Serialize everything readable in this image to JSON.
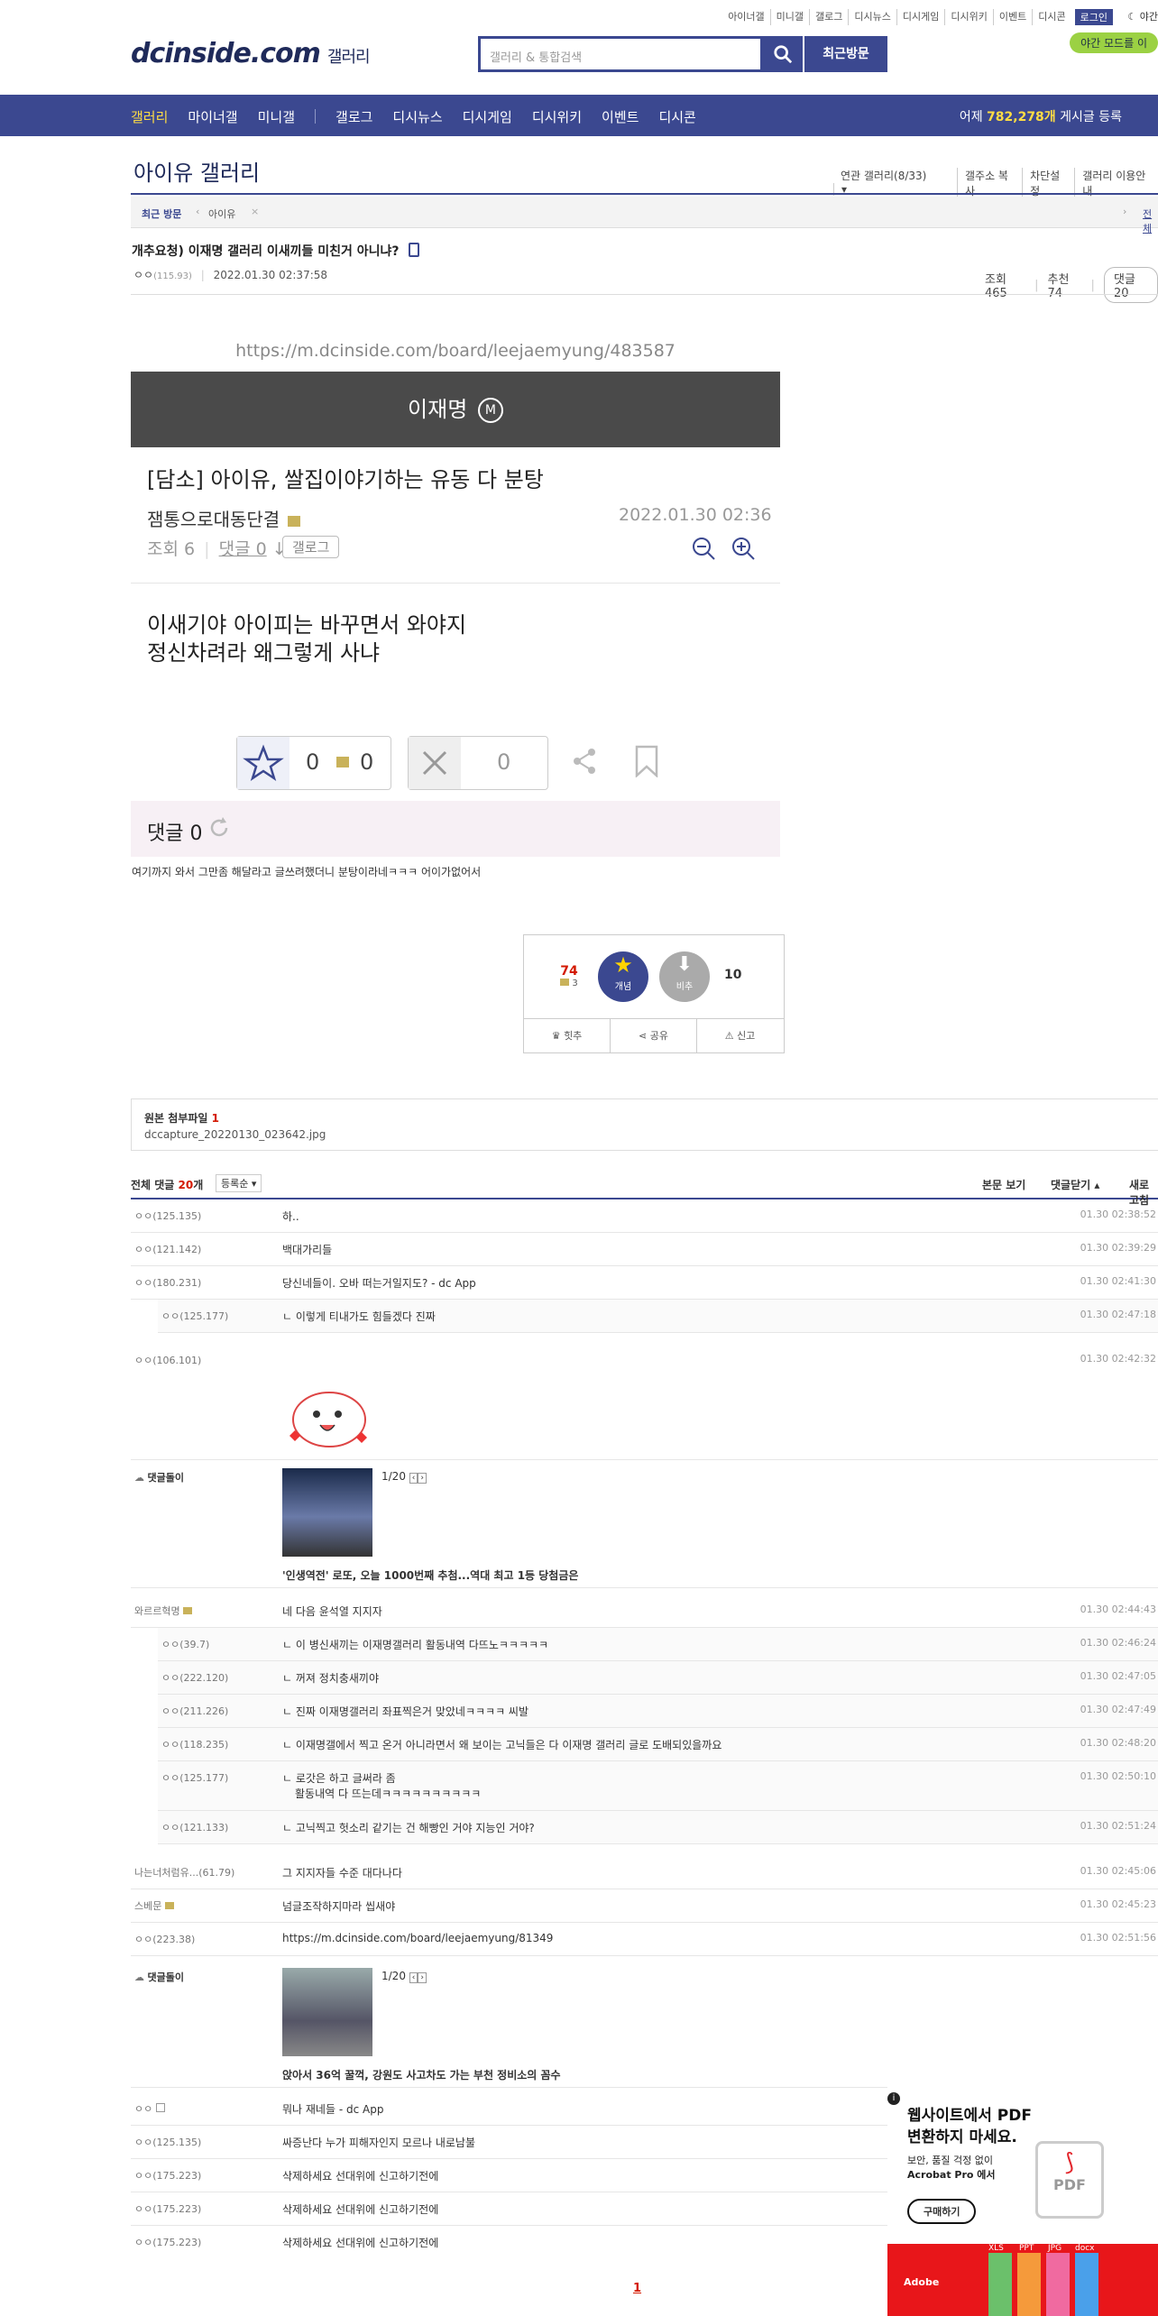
{
  "topnav": [
    "아이너갤",
    "미니갤",
    "갤로그",
    "디시뉴스",
    "디시게임",
    "디시위키",
    "이벤트",
    "디시콘"
  ],
  "login": "로그인",
  "night_label": "야간",
  "night_mode": "야간 모드를 이",
  "logo": "dcinside.com",
  "logo_suffix": "갤러리",
  "search_placeholder": "갤러리 & 통합검색",
  "recent_visit": "최근방문",
  "gnb": {
    "items": [
      "갤러리",
      "마이너갤",
      "미니갤",
      "갤로그",
      "디시뉴스",
      "디시게임",
      "디시위키",
      "이벤트",
      "디시콘"
    ],
    "stat_prefix": "어제",
    "stat_value": "782,278개",
    "stat_suffix": "게시글 등록"
  },
  "gallery_title": "아이유 갤러리",
  "gallery_tools": [
    "연관 갤러리(8/33)",
    "갤주소 복사",
    "차단설정",
    "갤러리 이용안내"
  ],
  "recentbar": {
    "label": "최근 방문",
    "item": "아이유",
    "right": "전체"
  },
  "post": {
    "title": "개추요청) 이재명 갤러리 이새끼들 미친거 아니냐?",
    "author": "ㅇㅇ",
    "ip": "(115.93)",
    "date": "2022.01.30 02:37:58",
    "views_label": "조회",
    "views": "465",
    "recommend_label": "추천",
    "recommend": "74",
    "comments_label": "댓글",
    "comments": "20"
  },
  "shot": {
    "url": "https://m.dcinside.com/board/leejaemyung/483587",
    "header": "이재명",
    "title": "[담소] 아이유, 쌀집이야기하는 유동 다 분탕",
    "author": "잼통으로대동단결",
    "date": "2022.01.30 02:36",
    "views": "조회 6",
    "comments": "댓글 0",
    "gallog": "갤로그",
    "body": "이새기야 아이피는 바꾸면서 와야지\n정신차려라 왜그렇게 사냐",
    "vote_up": "0",
    "vote_up_fix": "0",
    "vote_down": "0",
    "cmt_label": "댓글 0"
  },
  "desc": "여기까지 와서 그만좀 해달라고 글쓰려했더니 분탕이라네ㅋㅋㅋ 어이가없어서",
  "rec": {
    "up": "74",
    "fix": "3",
    "up_label": "개념",
    "down_label": "비추",
    "down": "10",
    "actions": [
      "힛추",
      "공유",
      "신고"
    ]
  },
  "attach": {
    "label": "원본 첨부파일",
    "count": "1",
    "file": "dccapture_20220130_023642.jpg"
  },
  "cmthead": {
    "label": "전체 댓글",
    "count": "20",
    "unit": "개",
    "sort": "등록순",
    "right": [
      "본문 보기",
      "댓글닫기",
      "새로고침"
    ]
  },
  "comments": [
    {
      "nick": "ㅇㅇ(125.135)",
      "text": "하..",
      "time": "01.30 02:38:52"
    },
    {
      "nick": "ㅇㅇ(121.142)",
      "text": "백대가리들",
      "time": "01.30 02:39:29"
    },
    {
      "nick": "ㅇㅇ(180.231)",
      "text": "당신네들이. 오바 떠는거일지도? - dc App",
      "time": "01.30 02:41:30"
    },
    {
      "nick": "ㅇㅇ(125.177)",
      "text": "이렇게 티내가도 힘들겠다 진짜",
      "time": "01.30 02:47:18",
      "reply": true
    },
    {
      "nick": "ㅇㅇ(106.101)",
      "text": "",
      "time": "01.30 02:42:32"
    },
    {
      "nick": "댓글돌이",
      "text": "'인생역전' 로또, 오늘 1000번째 추첨...역대 최고 1등 당첨금은",
      "page": "1/20"
    },
    {
      "nick": "와르르혁명",
      "text": "네 다음 윤석열 지지자",
      "time": "01.30 02:44:43"
    },
    {
      "nick": "ㅇㅇ(39.7)",
      "text": "이 병신새끼는 이재명갤러리 활동내역 다뜨노ㅋㅋㅋㅋㅋ",
      "time": "01.30 02:46:24",
      "reply": true
    },
    {
      "nick": "ㅇㅇ(222.120)",
      "text": "꺼져 정치충새끼야",
      "time": "01.30 02:47:05",
      "reply": true
    },
    {
      "nick": "ㅇㅇ(211.226)",
      "text": "진짜 이재명갤러리 좌표찍은거 맞았네ㅋㅋㅋㅋ 씨발",
      "time": "01.30 02:47:49",
      "reply": true
    },
    {
      "nick": "ㅇㅇ(118.235)",
      "text": "이재명갤에서 찍고 온거 아니라면서 왜 보이는 고닉들은 다 이재명 갤러리 글로 도배되있을까요",
      "time": "01.30 02:48:20",
      "reply": true
    },
    {
      "nick": "ㅇㅇ(125.177)",
      "text": "로갓은 하고 글써라 좀",
      "text2": "활동내역 다 뜨는데ㅋㅋㅋㅋㅋㅋㅋㅋㅋㅋ",
      "time": "01.30 02:50:10",
      "reply": true
    },
    {
      "nick": "ㅇㅇ(121.133)",
      "text": "고닉찍고 헛소리 같기는 건 해빵인 거야 지능인 거야?",
      "time": "01.30 02:51:24",
      "reply": true
    },
    {
      "nick": "나는너처럼유...(61.79)",
      "text": "그 지지자들 수준 대다나다",
      "time": "01.30 02:45:06"
    },
    {
      "nick": "스베문",
      "text": "넘글조작하지마라 씹새야",
      "time": "01.30 02:45:23"
    },
    {
      "nick": "ㅇㅇ(223.38)",
      "text": "https://m.dcinside.com/board/leejaemyung/81349",
      "time": "01.30 02:51:56"
    },
    {
      "nick": "댓글돌이",
      "text": "앉아서 36억 꿀꺽, 강원도 사고차도 가는 부천 정비소의 꼼수",
      "page": "1/20"
    },
    {
      "nick": "ㅇㅇ",
      "text": "뭐나 재네들 - dc App"
    },
    {
      "nick": "ㅇㅇ(125.135)",
      "text": "싸증난다 누가 피해자인지 모르나 내로남불"
    },
    {
      "nick": "ㅇㅇ(175.223)",
      "text": "삭제하세요 선대위에 신고하기전에"
    },
    {
      "nick": "ㅇㅇ(175.223)",
      "text": "삭제하세요 선대위에 신고하기전에"
    },
    {
      "nick": "ㅇㅇ(175.223)",
      "text": "삭제하세요 선대위에 신고하기전에"
    }
  ],
  "pagination": "1",
  "ad": {
    "title1": "웹사이트에서 PDF",
    "title2": "변환하지 마세요.",
    "sub1": "보안, 품질 걱정 없이",
    "sub2": "Acrobat Pro 에서",
    "cta": "구매하기",
    "pdf": "PDF",
    "brand": "Adobe",
    "formats": [
      "XLS",
      "PPT",
      "JPG",
      "docx"
    ]
  }
}
